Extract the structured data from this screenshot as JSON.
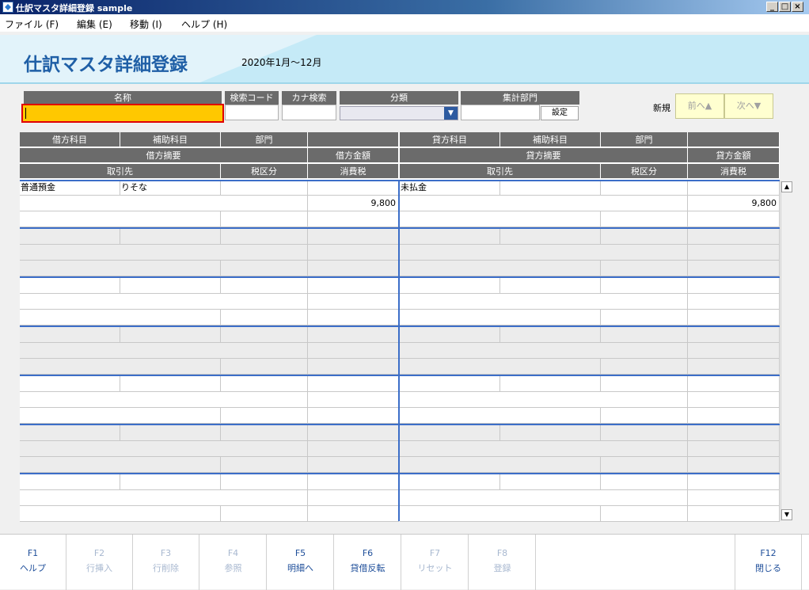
{
  "window": {
    "title": "仕訳マスタ詳細登録 sample",
    "min": "_",
    "max": "□",
    "close": "×"
  },
  "menu": [
    "ファイル (F)",
    "編集 (E)",
    "移動 (I)",
    "ヘルプ (H)"
  ],
  "header": {
    "title": "仕訳マスタ詳細登録",
    "period": "2020年1月～12月"
  },
  "search": {
    "name_label": "名称",
    "code_label": "検索コード",
    "kana_label": "カナ検索",
    "category_label": "分類",
    "dept_label": "集計部門",
    "set_button": "設定",
    "new_label": "新規",
    "prev_button": "前へ▲",
    "next_button": "次へ▼"
  },
  "grid": {
    "debit_headers": {
      "account": "借方科目",
      "sub": "補助科目",
      "dept": "部門",
      "memo": "借方摘要",
      "amount": "借方金額",
      "partner": "取引先",
      "tax_class": "税区分",
      "tax": "消費税"
    },
    "credit_headers": {
      "account": "貸方科目",
      "sub": "補助科目",
      "dept": "部門",
      "memo": "貸方摘要",
      "amount": "貸方金額",
      "partner": "取引先",
      "tax_class": "税区分",
      "tax": "消費税"
    },
    "entry1": {
      "debit_account": "普通預金",
      "debit_sub": "りそな",
      "debit_amount": "9,800",
      "credit_account": "未払金",
      "credit_amount": "9,800"
    }
  },
  "scroll": {
    "up": "▲",
    "down": "▼"
  },
  "fkeys": [
    {
      "key": "F1",
      "label": "ヘルプ",
      "enabled": true
    },
    {
      "key": "F2",
      "label": "行挿入",
      "enabled": false
    },
    {
      "key": "F3",
      "label": "行削除",
      "enabled": false
    },
    {
      "key": "F4",
      "label": "参照",
      "enabled": false
    },
    {
      "key": "F5",
      "label": "明細へ",
      "enabled": true
    },
    {
      "key": "F6",
      "label": "貸借反転",
      "enabled": true
    },
    {
      "key": "F7",
      "label": "リセット",
      "enabled": false
    },
    {
      "key": "F8",
      "label": "登録",
      "enabled": false
    },
    {
      "key": "F12",
      "label": "閉じる",
      "enabled": true
    }
  ]
}
